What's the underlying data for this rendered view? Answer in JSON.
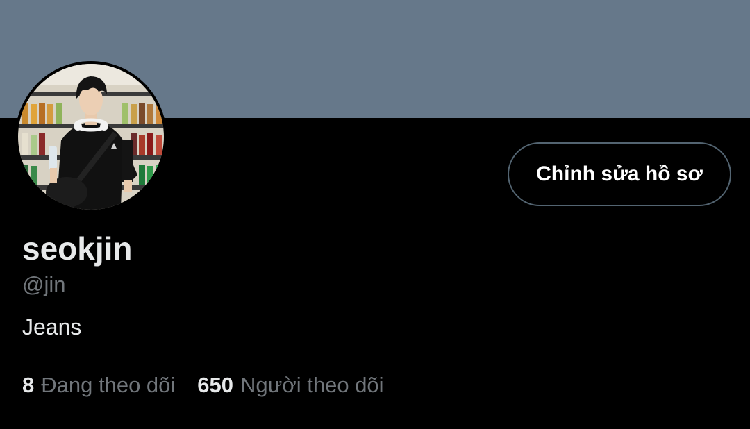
{
  "profile": {
    "display_name": "seokjin",
    "handle": "@jin",
    "bio": "Jeans",
    "edit_button_label": "Chỉnh sửa hồ sơ",
    "avatar_alt": "profile photo",
    "banner_color": "#66788a"
  },
  "stats": {
    "following_count": "8",
    "following_label": "Đang theo dõi",
    "followers_count": "650",
    "followers_label": "Người theo dõi"
  },
  "colors": {
    "background": "#000000",
    "primary_text": "#e7e9ea",
    "secondary_text": "#71767b",
    "button_border": "#536471"
  }
}
